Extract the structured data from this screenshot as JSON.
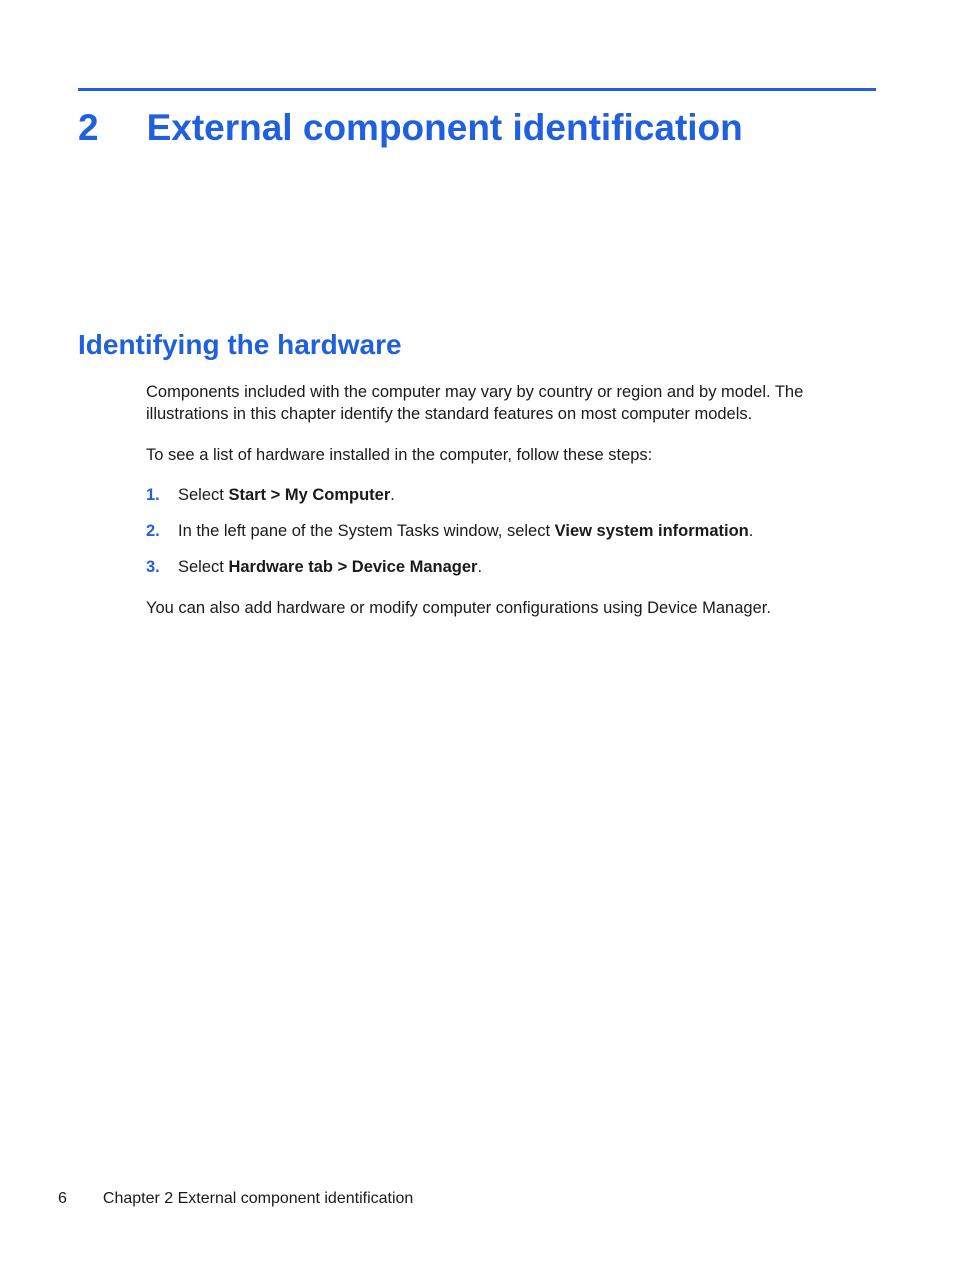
{
  "chapter": {
    "number": "2",
    "title": "External component identification"
  },
  "section": {
    "title": "Identifying the hardware"
  },
  "body": {
    "intro": "Components included with the computer may vary by country or region and by model. The illustrations in this chapter identify the standard features on most computer models.",
    "leadin": "To see a list of hardware installed in the computer, follow these steps:",
    "steps": [
      {
        "num": "1.",
        "prefix": "Select ",
        "bold": "Start > My Computer",
        "suffix": "."
      },
      {
        "num": "2.",
        "prefix": "In the left pane of the System Tasks window, select ",
        "bold": "View system information",
        "suffix": "."
      },
      {
        "num": "3.",
        "prefix": "Select ",
        "bold": "Hardware tab > Device Manager",
        "suffix": "."
      }
    ],
    "closing": "You can also add hardware or modify computer configurations using Device Manager."
  },
  "footer": {
    "page": "6",
    "text": "Chapter 2   External component identification"
  }
}
